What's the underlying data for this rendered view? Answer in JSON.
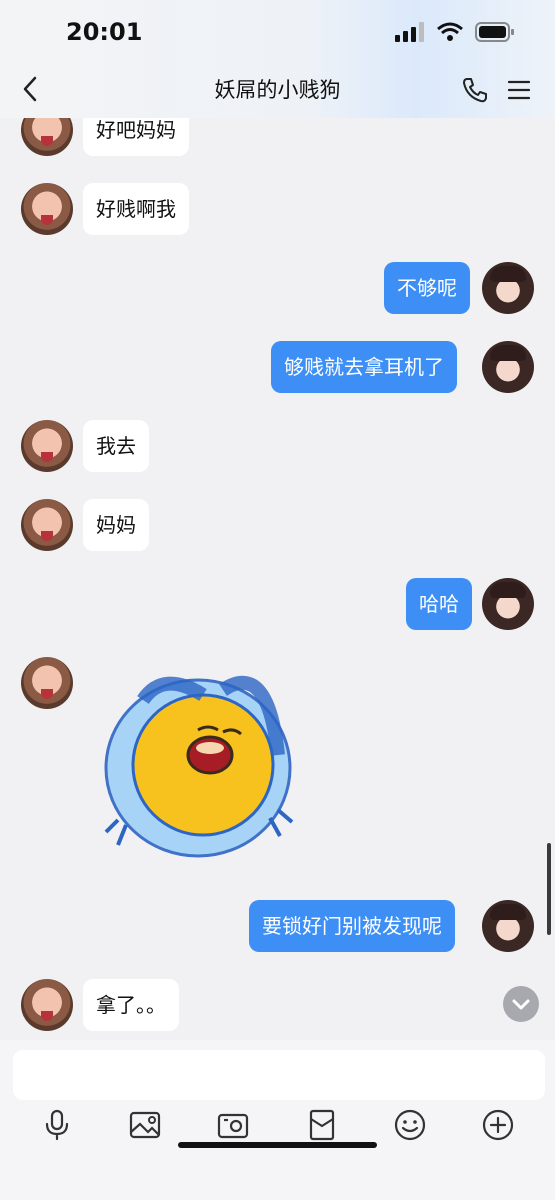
{
  "status_bar": {
    "time": "20:01"
  },
  "header": {
    "title": "妖屌的小贱狗"
  },
  "messages": [
    {
      "side": "left",
      "text": "好吧妈妈"
    },
    {
      "side": "left",
      "text": "好贱啊我"
    },
    {
      "side": "right",
      "text": "不够呢"
    },
    {
      "side": "right",
      "text": "够贱就去拿耳机了"
    },
    {
      "side": "left",
      "text": "我去"
    },
    {
      "side": "left",
      "text": "妈妈"
    },
    {
      "side": "right",
      "text": "哈哈"
    },
    {
      "side": "left",
      "sticker": "crying-face-sticker"
    },
    {
      "side": "right",
      "text": "要锁好门别被发现呢"
    },
    {
      "side": "left",
      "text": "拿了。。"
    }
  ],
  "composer": {
    "input_value": "",
    "tools": [
      "microphone-icon",
      "image-icon",
      "camera-icon",
      "red-envelope-icon",
      "emoji-icon",
      "plus-icon"
    ]
  },
  "colors": {
    "outgoing_bubble": "#3d8ff5",
    "incoming_bubble": "#ffffff",
    "background": "#f1f1f3"
  }
}
